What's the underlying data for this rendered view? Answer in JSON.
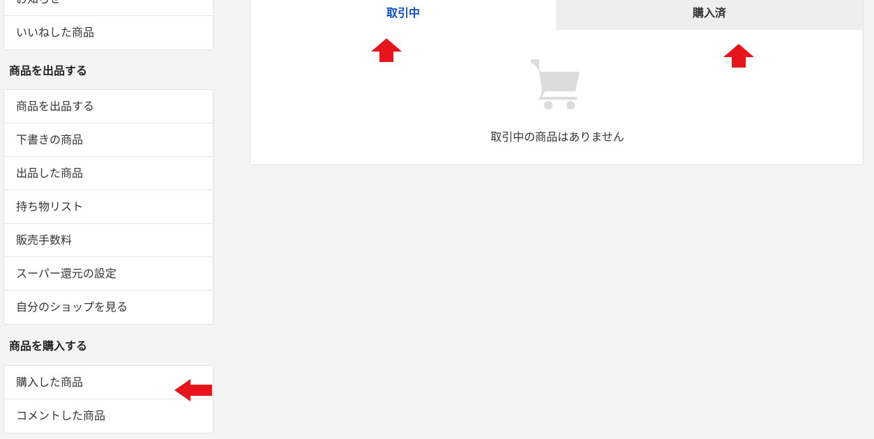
{
  "sidebar": {
    "top_items": [
      "お知らせ",
      "いいねした商品"
    ],
    "sell_heading": "商品を出品する",
    "sell_items": [
      "商品を出品する",
      "下書きの商品",
      "出品した商品",
      "持ち物リスト",
      "販売手数料",
      "スーパー還元の設定",
      "自分のショップを見る"
    ],
    "buy_heading": "商品を購入する",
    "buy_items": [
      "購入した商品",
      "コメントした商品"
    ]
  },
  "tabs": {
    "active": "取引中",
    "inactive": "購入済"
  },
  "empty_state": {
    "icon": "cart-icon",
    "message": "取引中の商品はありません"
  },
  "colors": {
    "active_tab_text": "#0b4cc7",
    "annotation_arrow": "#e8141c",
    "cart_icon": "#dcdcdc"
  }
}
